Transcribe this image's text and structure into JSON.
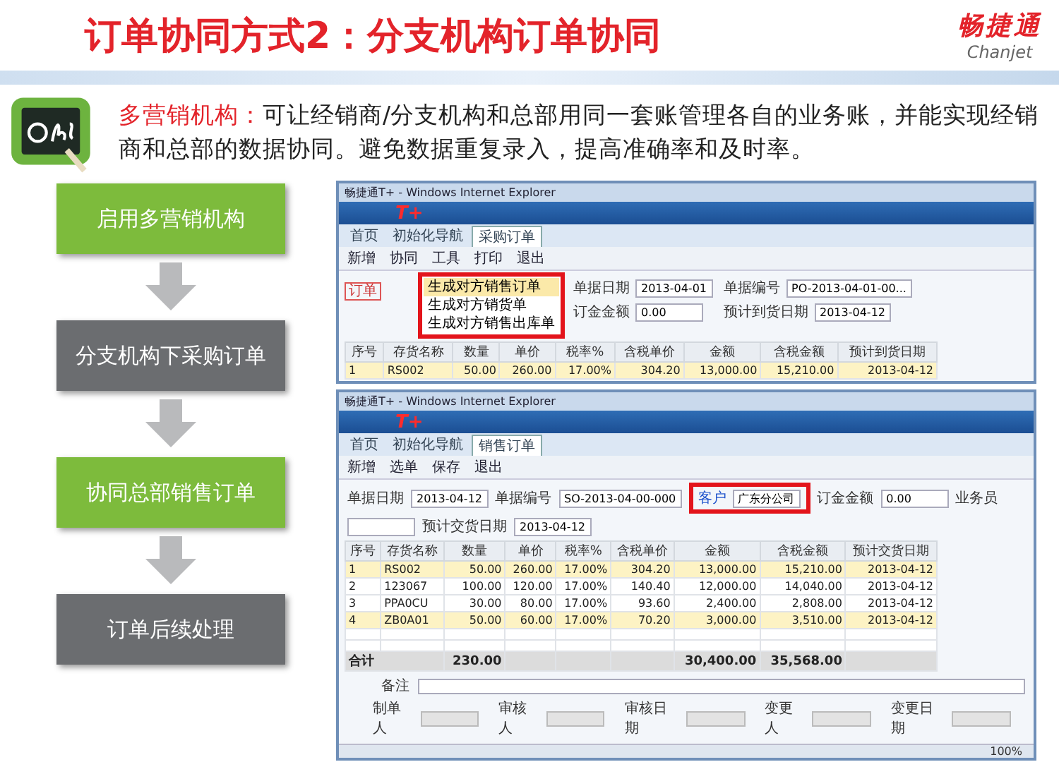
{
  "title": "订单协同方式2：分支机构订单协同",
  "logo": {
    "name": "畅捷通",
    "latin": "Chanjet"
  },
  "intro": {
    "term": "多营销机构：",
    "text": "可让经销商/分支机构和总部用同一套账管理各自的业务账，并能实现经销商和总部的数据协同。避免数据重复录入，提高准确率和及时率。"
  },
  "steps": [
    {
      "label": "启用多营销机构",
      "color": "#7dbb3c"
    },
    {
      "label": "分支机构下采购订单",
      "color": "#6b6d70"
    },
    {
      "label": "协同总部销售订单",
      "color": "#7dbb3c"
    },
    {
      "label": "订单后续处理",
      "color": "#6b6d70"
    }
  ],
  "purchase_window": {
    "title": "畅捷通T+ - Windows Internet Explorer",
    "brand": "T+",
    "tabs": [
      {
        "label": "首页",
        "selected": false
      },
      {
        "label": "初始化导航",
        "selected": false
      },
      {
        "label": "采购订单",
        "selected": true
      }
    ],
    "toolbar": [
      "新增",
      "协同",
      "工具",
      "打印",
      "退出"
    ],
    "menu": [
      {
        "label": "生成对方销售订单",
        "selected": true
      },
      {
        "label": "生成对方销货单",
        "selected": false
      },
      {
        "label": "生成对方销售出库单",
        "selected": false
      }
    ],
    "tag": "订单",
    "fields": [
      {
        "label": "单据日期",
        "value": "2013-04-01"
      },
      {
        "label": "单据编号",
        "value": "PO-2013-04-01-00..."
      },
      {
        "label": "订金金额",
        "value": "0.00"
      },
      {
        "label": "预计到货日期",
        "value": "2013-04-12"
      }
    ],
    "columns": [
      "序号",
      "存货名称",
      "数量",
      "单价",
      "税率%",
      "含税单价",
      "金额",
      "含税金额",
      "预计到货日期"
    ],
    "rows": [
      [
        "1",
        "RS002",
        "50.00",
        "260.00",
        "17.00%",
        "304.20",
        "13,000.00",
        "15,210.00",
        "2013-04-12"
      ]
    ]
  },
  "sales_window": {
    "title": "畅捷通T+ - Windows Internet Explorer",
    "brand": "T+",
    "tabs": [
      {
        "label": "首页",
        "selected": false
      },
      {
        "label": "初始化导航",
        "selected": false
      },
      {
        "label": "销售订单",
        "selected": true
      }
    ],
    "toolbar": [
      "新增",
      "选单",
      "保存",
      "退出"
    ],
    "fields": [
      {
        "label": "单据日期",
        "value": "2013-04-12"
      },
      {
        "label": "单据编号",
        "value": "SO-2013-04-00-000"
      },
      {
        "label": "客户",
        "value": "广东分公司"
      },
      {
        "label": "订金金额",
        "value": "0.00"
      },
      {
        "label": "业务员"
      },
      {
        "label": "预计交货日期",
        "value": "2013-04-12"
      }
    ],
    "columns": [
      "序号",
      "存货名称",
      "数量",
      "单价",
      "税率%",
      "含税单价",
      "金额",
      "含税金额",
      "预计交货日期"
    ],
    "rows": [
      [
        "1",
        "RS002",
        "50.00",
        "260.00",
        "17.00%",
        "304.20",
        "13,000.00",
        "15,210.00",
        "2013-04-12"
      ],
      [
        "2",
        "123067",
        "100.00",
        "120.00",
        "17.00%",
        "140.40",
        "12,000.00",
        "14,040.00",
        "2013-04-12"
      ],
      [
        "3",
        "PPA0CU",
        "30.00",
        "80.00",
        "17.00%",
        "93.60",
        "2,400.00",
        "2,808.00",
        "2013-04-12"
      ],
      [
        "4",
        "ZB0A01",
        "50.00",
        "60.00",
        "17.00%",
        "70.20",
        "3,000.00",
        "3,510.00",
        "2013-04-12"
      ]
    ],
    "total": {
      "label": "合计",
      "quantity": "230.00",
      "amount": "30,400.00",
      "tax_amount": "35,568.00"
    },
    "note_label": "备注",
    "footer_fields": [
      "制单人",
      "审核人",
      "审核日期",
      "变更人",
      "变更日期"
    ],
    "zoom": "100%"
  }
}
